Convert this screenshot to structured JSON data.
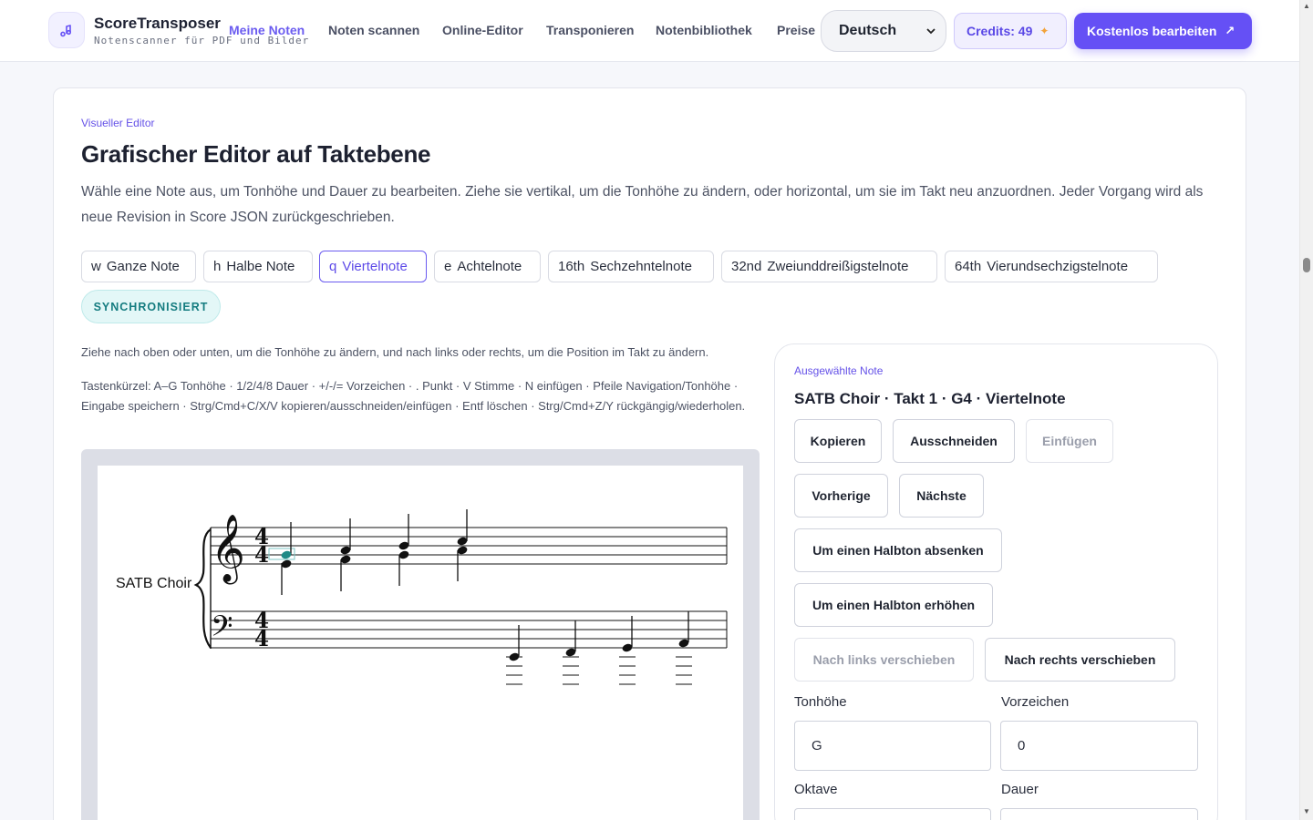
{
  "header": {
    "brand_name": "ScoreTransposer",
    "brand_sub": "Notenscanner für PDF und Bilder",
    "nav": [
      "Meine Noten",
      "Noten scannen",
      "Online-Editor",
      "Transponieren",
      "Notenbibliothek",
      "Preise"
    ],
    "language": "Deutsch",
    "credits": "Credits: 49",
    "cta": "Kostenlos bearbeiten"
  },
  "main": {
    "eyebrow": "Visueller Editor",
    "title": "Grafischer Editor auf Taktebene",
    "description": "Wähle eine Note aus, um Tonhöhe und Dauer zu bearbeiten. Ziehe sie vertikal, um die Tonhöhe zu ändern, oder horizontal, um sie im Takt neu anzuordnen. Jeder Vorgang wird als neue Revision in Score JSON zurückgeschrieben.",
    "durations": [
      {
        "symbol": "w",
        "label": "Ganze Note"
      },
      {
        "symbol": "h",
        "label": "Halbe Note"
      },
      {
        "symbol": "q",
        "label": "Viertelnote"
      },
      {
        "symbol": "e",
        "label": "Achtelnote"
      },
      {
        "symbol": "16th",
        "label": "Sechzehntelnote"
      },
      {
        "symbol": "32nd",
        "label": "Zweiunddreißigstelnote"
      },
      {
        "symbol": "64th",
        "label": "Vierundsechzigstelnote"
      }
    ],
    "active_duration": "Viertelnote",
    "sync_status": "SYNCHRONISIERT",
    "hint_drag": "Ziehe nach oben oder unten, um die Tonhöhe zu ändern, und nach links oder rechts, um die Position im Takt zu ändern.",
    "hint_shortcuts": "Tastenkürzel: A–G Tonhöhe · 1/2/4/8 Dauer · +/-/= Vorzeichen · . Punkt · V Stimme · N einfügen · Pfeile Navigation/Tonhöhe · Eingabe speichern · Strg/Cmd+C/X/V kopieren/ausschneiden/einfügen · Entf löschen · Strg/Cmd+Z/Y rückgängig/wiederholen.",
    "score": {
      "part_name": "SATB Choir",
      "time_signature": "4/4",
      "selected_color": "#1f8a86"
    }
  },
  "panel": {
    "eyebrow": "Ausgewählte Note",
    "title": "SATB Choir · Takt 1 · G4 · Viertelnote",
    "buttons": {
      "copy": "Kopieren",
      "cut": "Ausschneiden",
      "paste": "Einfügen",
      "prev": "Vorherige",
      "next": "Nächste",
      "semitone_down": "Um einen Halbton absenken",
      "semitone_up": "Um einen Halbton erhöhen",
      "move_left": "Nach links verschieben",
      "move_right": "Nach rechts verschieben"
    },
    "fields": {
      "pitch_label": "Tonhöhe",
      "pitch_value": "G",
      "accidental_label": "Vorzeichen",
      "accidental_value": "0",
      "octave_label": "Oktave",
      "duration_label": "Dauer"
    }
  },
  "colors": {
    "accent": "#6550f5",
    "sync": "#157c80"
  }
}
